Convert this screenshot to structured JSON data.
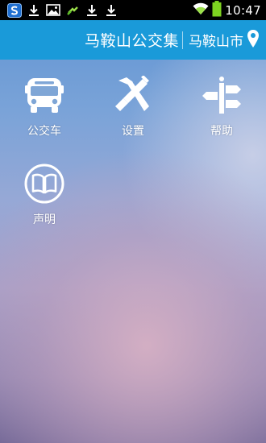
{
  "status_bar": {
    "time": "10:47",
    "icons": [
      "app-s-icon",
      "download-icon",
      "image-icon",
      "sync-icon",
      "download-icon",
      "download-icon",
      "wifi-icon",
      "battery-icon"
    ]
  },
  "header": {
    "title": "马鞍山公交集",
    "city": "马鞍山市"
  },
  "menu": [
    {
      "label": "公交车",
      "icon": "bus-icon"
    },
    {
      "label": "设置",
      "icon": "settings-icon"
    },
    {
      "label": "帮助",
      "icon": "help-signpost-icon"
    },
    {
      "label": "声明",
      "icon": "book-icon"
    }
  ],
  "colors": {
    "title_bar": "#1a9ad9",
    "status_bar": "#000000",
    "battery": "#7ed321"
  }
}
